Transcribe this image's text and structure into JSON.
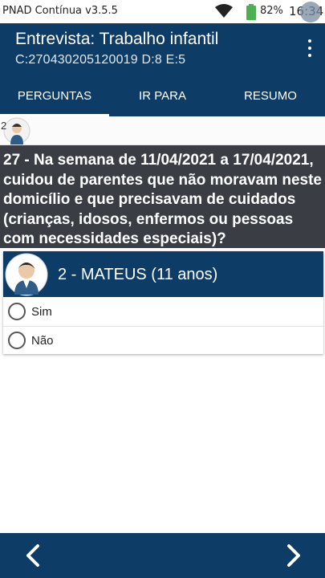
{
  "status_bar": {
    "app_version": "PNAD Contínua v3.5.5",
    "battery_percent": "82%",
    "time": "16:34",
    "icons": [
      "wifi-icon",
      "battery-icon"
    ]
  },
  "app_bar": {
    "title": "Entrevista: Trabalho infantil",
    "subtitle": "C:270430205120019 D:8 E:5",
    "menu_icon": "more-vertical-icon"
  },
  "tabs": [
    {
      "label": "PERGUNTAS",
      "active": true
    },
    {
      "label": "IR PARA",
      "active": false
    },
    {
      "label": "RESUMO",
      "active": false
    }
  ],
  "avatar_strip": {
    "person_number": "2"
  },
  "question": {
    "text": "27 - Na semana de 11/04/2021 a 17/04/2021, cuidou de parentes que não moravam neste domicílio e que precisavam de cuidados (crianças, idosos, enfermos ou pessoas com necessidades especiais)?"
  },
  "person_card": {
    "name": "2 - MATEUS (11 anos)",
    "options": [
      {
        "label": "Sim",
        "selected": false
      },
      {
        "label": "Não",
        "selected": false
      }
    ]
  },
  "bottom_nav": {
    "prev_icon": "chevron-left-icon",
    "next_icon": "chevron-right-icon"
  },
  "colors": {
    "primary": "#0d3c66",
    "question_bg": "#3a3e44",
    "text_on_primary": "#ffffff"
  }
}
